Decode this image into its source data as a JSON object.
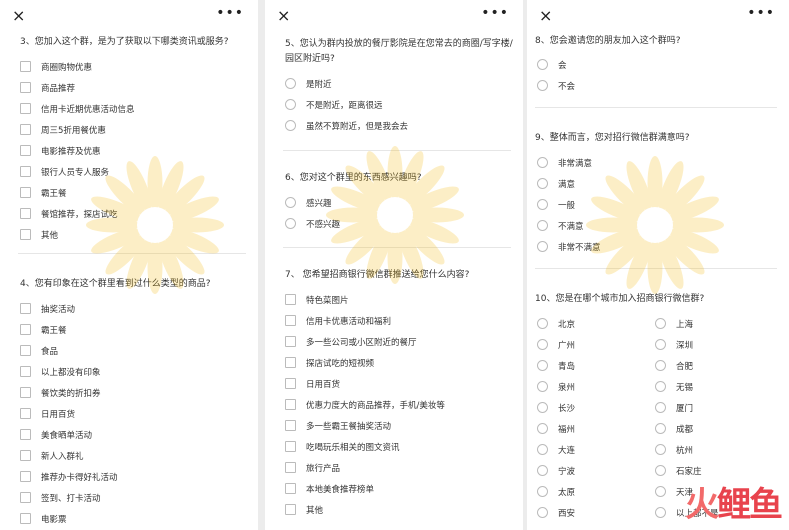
{
  "panels": {
    "p1": {
      "q3": "3、您加入这个群，是为了获取以下哪类资讯或服务?",
      "q3_options": [
        "商圈购物优惠",
        "商品推荐",
        "信用卡近期优惠活动信息",
        "周三5折用餐优惠",
        "电影推荐及优惠",
        "银行人员专人服务",
        "霸王餐",
        "餐馆推荐，探店试吃",
        "其他"
      ],
      "q4": "4、您有印象在这个群里看到过什么类型的商品?",
      "q4_options": [
        "抽奖活动",
        "霸王餐",
        "食品",
        "以上都没有印象",
        "餐饮类的折扣券",
        "日用百货",
        "美食晒单活动",
        "新人入群礼",
        "推荐办卡得好礼活动",
        "签到、打卡活动",
        "电影票"
      ]
    },
    "p2": {
      "q5": "5、您认为群内投放的餐厅影院是在您常去的商圈/写字楼/园区附近吗?",
      "q5_options": [
        "是附近",
        "不是附近，距离很远",
        "虽然不算附近，但是我会去"
      ],
      "q6": "6、您对这个群里的东西感兴趣吗?",
      "q6_options": [
        "感兴趣",
        "不感兴趣"
      ],
      "q7": "7、 您希望招商银行微信群推送给您什么内容?",
      "q7_options": [
        "特色菜图片",
        "信用卡优惠活动和福利",
        "多一些公司或小区附近的餐厅",
        "探店试吃的短视频",
        "日用百货",
        "优惠力度大的商品推荐，手机/美妆等",
        "多一些霸王餐抽奖活动",
        "吃喝玩乐相关的图文资讯",
        "旅行产品",
        "本地美食推荐榜单",
        "其他"
      ]
    },
    "p3": {
      "q8": "8、您会邀请您的朋友加入这个群吗?",
      "q8_options": [
        "会",
        "不会"
      ],
      "q9": "9、整体而言，您对招行微信群满意吗?",
      "q9_options": [
        "非常满意",
        "满意",
        "一般",
        "不满意",
        "非常不满意"
      ],
      "q10": "10、您是在哪个城市加入招商银行微信群?",
      "q10_left": [
        "北京",
        "广州",
        "青岛",
        "泉州",
        "长沙",
        "福州",
        "大连",
        "宁波",
        "太原",
        "西安"
      ],
      "q10_right": [
        "上海",
        "深圳",
        "合肥",
        "无锡",
        "厦门",
        "成都",
        "杭州",
        "石家庄",
        "天津",
        "以上都不是"
      ]
    }
  },
  "icons": {
    "close": "×",
    "more": "•••"
  },
  "logo": {
    "part1": "火",
    "part2": "鲤鱼"
  },
  "colors": {
    "accent": "#f5b700",
    "logo": "#e8434d"
  }
}
